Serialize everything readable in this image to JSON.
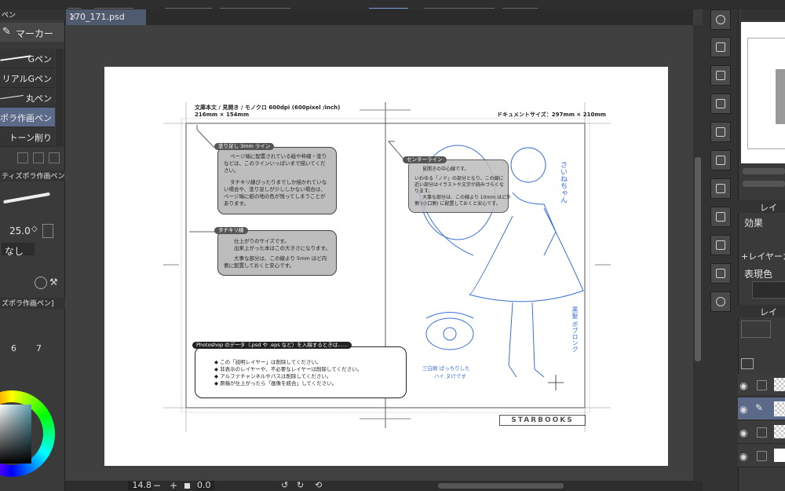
{
  "document_tab": {
    "title": "170_171.psd",
    "close": "✕"
  },
  "left_panel": {
    "header_label": "ペン",
    "tool_label": "マーカー",
    "brushes": [
      {
        "label": "Gペン"
      },
      {
        "label": "リアルGペン"
      },
      {
        "label": "丸ペン"
      },
      {
        "label": "ポラ作画ペン"
      },
      {
        "label": "トーン削り"
      }
    ],
    "subtool_title": "ティズポラ作画ペン]",
    "brush_size": "25.0",
    "aa_value": "なし",
    "subtool_title2": "ズポラ作画ペン]",
    "size_numbers": [
      "6",
      "7"
    ]
  },
  "bottom_bar": {
    "zoom": "14.8",
    "minus": "−",
    "plus": "+",
    "rotation": "0.0"
  },
  "right_panel": {
    "tab_layer_short": "レイ",
    "effect_label": "効果",
    "layer_tab_label": "+レイヤーカ",
    "expression_label": "表現色",
    "layer_tab2": "レイ"
  },
  "page": {
    "header_left_line1": "文庫本文 / 見開き / モノクロ 600dpi (600pixel /inch)",
    "header_left_line2": "216mm × 154mm",
    "header_right": "ドキュメントサイズ：297mm × 210mm",
    "callout1": {
      "tag": "塗り足し 3mm ライン",
      "lines": [
        "ページ端に配置されている絵や枠線・塗り",
        "などは、このラインいっぱいまで描いてくだ",
        "さい。",
        "",
        "タチキリ線ぴったりまでしか描かれていな",
        "い場合や、塗り足しが少ししかない場合は、",
        "ページ端に紙の地の色が残ってしまうことが",
        "あります。"
      ]
    },
    "callout2": {
      "tag": "タチキリ線",
      "lines": [
        "仕上がりのサイズです。",
        "出来上がった本はこの大きさになります。",
        "",
        "大事な部分は、この線より 5mm ほど内",
        "側に配置しておくと安心です。"
      ]
    },
    "callout3": {
      "tag": "センターライン",
      "lines": [
        "見開きの中心線です。",
        "",
        "いわゆる「ノド」の部分となり、この線に",
        "近い部分はイラストや文字が読みづらくな",
        "ります。",
        "大事な部分は、この線より 10mm ほど外",
        "側 (小口側) に配置しておくと安心です。"
      ]
    },
    "notice": {
      "title": "Photoshop のデータ（.psd や .eps など）を入稿するときは……",
      "items": [
        "この「説明レイヤー」は削除してください。",
        "非表示のレイヤーや、不必要なレイヤーは削除してください。",
        "アルファチャンネルやパスは削除してください。",
        "原稿が仕上がったら「画像を統合」してください。"
      ],
      "bullet": "◆"
    },
    "logo": "STARBOOKS",
    "sketch_notes": [
      "さいねちゃん",
      "黒髪 ボブロング",
      "三白眼 ぱっちりした",
      "ハイ ヌけです"
    ]
  },
  "colors": {
    "accent_selected": "#5a6a88",
    "sketch_blue": "#3a6fd8",
    "panel_bg": "#3a3a3a"
  }
}
